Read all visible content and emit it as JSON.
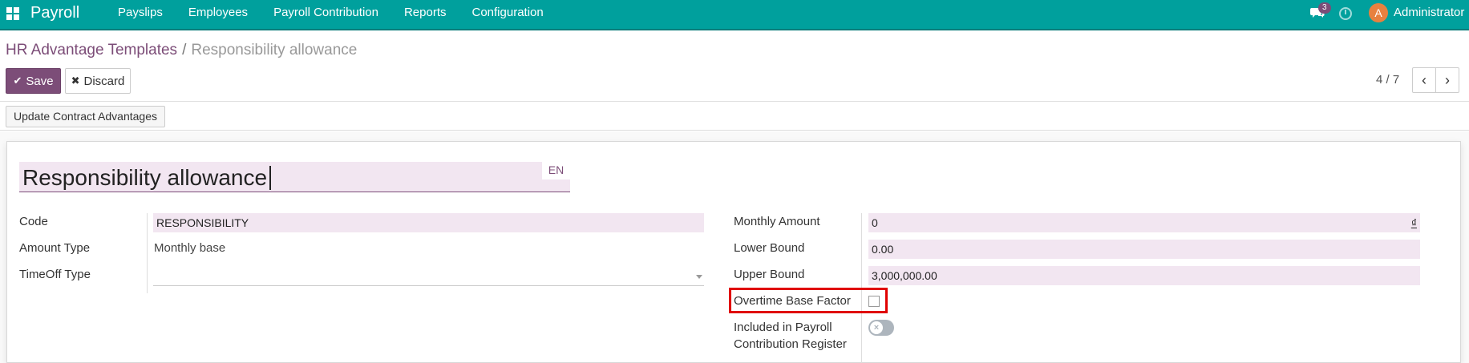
{
  "navbar": {
    "app_name": "Payroll",
    "menu": [
      {
        "label": "Payslips"
      },
      {
        "label": "Employees"
      },
      {
        "label": "Payroll Contribution"
      },
      {
        "label": "Reports"
      },
      {
        "label": "Configuration"
      }
    ],
    "messages_count": "3",
    "avatar_letter": "A",
    "user_name": "Administrator",
    "color": "#00A09D"
  },
  "breadcrumb": {
    "parent": "HR Advantage Templates",
    "separator": "/",
    "current": "Responsibility allowance"
  },
  "toolbar": {
    "save_label": "Save",
    "discard_label": "Discard",
    "save_color": "#7C4D78"
  },
  "pager": {
    "value": "4 / 7"
  },
  "statusbar": {
    "update_button": "Update Contract Advantages"
  },
  "form": {
    "name": "Responsibility allowance",
    "lang": "EN",
    "left": {
      "code_label": "Code",
      "code_value": "RESPONSIBILITY",
      "amount_type_label": "Amount Type",
      "amount_type_value": "Monthly base",
      "timeoff_label": "TimeOff Type",
      "timeoff_value": ""
    },
    "right": {
      "monthly_amount_label": "Monthly Amount",
      "monthly_amount_value": "0",
      "currency_symbol": "₫",
      "lower_bound_label": "Lower Bound",
      "lower_bound_value": "0.00",
      "upper_bound_label": "Upper Bound",
      "upper_bound_value": "3,000,000.00",
      "overtime_label": "Overtime Base Factor",
      "overtime_checked": false,
      "included_label_line1": "Included in Payroll",
      "included_label_line2": "Contribution Register",
      "included_enabled": false
    }
  }
}
